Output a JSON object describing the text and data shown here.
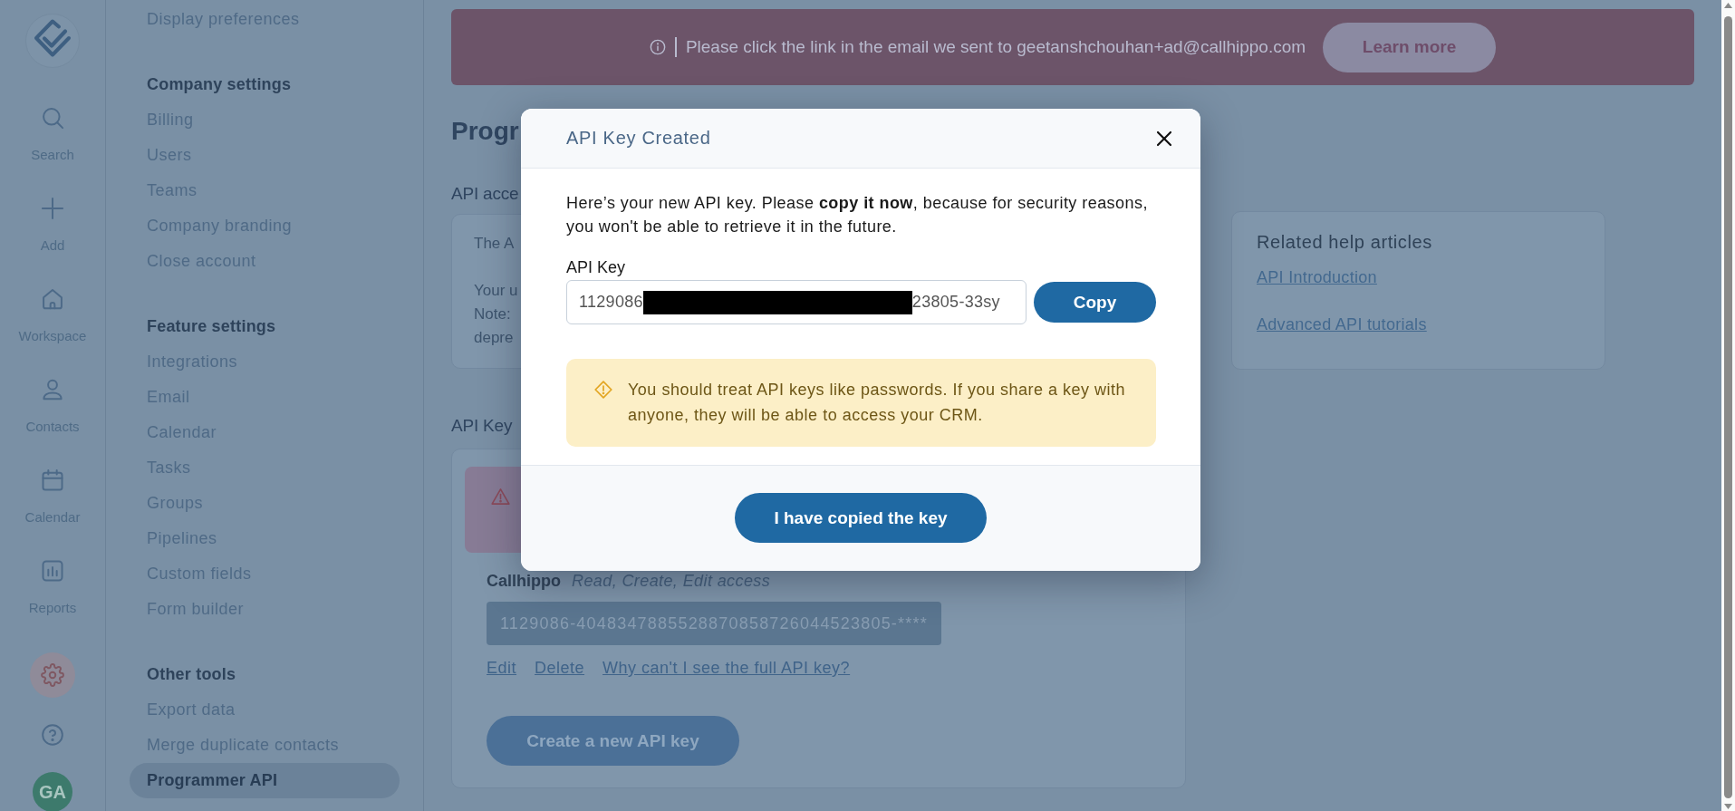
{
  "nav_rail": {
    "items": [
      {
        "label": "Search",
        "selected": false
      },
      {
        "label": "Add",
        "selected": false
      },
      {
        "label": "Workspace",
        "selected": false
      },
      {
        "label": "Contacts",
        "selected": false
      },
      {
        "label": "Calendar",
        "selected": false
      },
      {
        "label": "Reports",
        "selected": false
      }
    ],
    "bottom_items": [
      {
        "selected": true
      },
      {
        "selected": false
      }
    ],
    "avatar": {
      "initials": "GA"
    }
  },
  "sidebar": {
    "sections": [
      {
        "items": [
          {
            "label": "Display preferences",
            "selected": false
          }
        ]
      },
      {
        "title": "Company settings",
        "items": [
          {
            "label": "Billing",
            "selected": false
          },
          {
            "label": "Users",
            "selected": false
          },
          {
            "label": "Teams",
            "selected": false
          },
          {
            "label": "Company branding",
            "selected": false
          },
          {
            "label": "Close account",
            "selected": false
          }
        ]
      },
      {
        "title": "Feature settings",
        "items": [
          {
            "label": "Integrations",
            "selected": false
          },
          {
            "label": "Email",
            "selected": false
          },
          {
            "label": "Calendar",
            "selected": false
          },
          {
            "label": "Tasks",
            "selected": false
          },
          {
            "label": "Groups",
            "selected": false
          },
          {
            "label": "Pipelines",
            "selected": false
          },
          {
            "label": "Custom fields",
            "selected": false
          },
          {
            "label": "Form builder",
            "selected": false
          }
        ]
      },
      {
        "title": "Other tools",
        "items": [
          {
            "label": "Export data",
            "selected": false
          },
          {
            "label": "Merge duplicate contacts",
            "selected": false
          },
          {
            "label": "Programmer API",
            "selected": true
          }
        ]
      }
    ]
  },
  "banner": {
    "message": "Please click the link in the email we sent to geetanshchouhan+ad@callhippo.com",
    "button": "Learn more"
  },
  "page": {
    "title": "Progr",
    "access_section": {
      "heading": "API acce",
      "paragraphs": [
        {
          "lines": [
            "The A"
          ]
        },
        {
          "lines": [
            "Your u",
            "Note:",
            "depre"
          ]
        }
      ]
    },
    "keys_section": {
      "heading": "API Key",
      "keys": [
        {
          "name": "Callhippo",
          "access": "Read, Create, Edit access",
          "masked_value": "1129086-4048347885528870858726044523805-****",
          "links": [
            "Edit",
            "Delete",
            "Why can't I see the full API key?"
          ]
        }
      ],
      "create_button": "Create a new API key"
    },
    "help_card": {
      "title": "Related help articles",
      "links": [
        "API Introduction",
        "Advanced API tutorials"
      ]
    }
  },
  "modal": {
    "title": "API Key Created",
    "intro": "Here’s your new API key. Please **copy it now**, because for security reasons, you won't be able to retrieve it in the future.",
    "field_label": "API Key",
    "key_field": {
      "value_start": "1129086",
      "redacted": true,
      "value_end": "23805-33sy"
    },
    "copy_button": "Copy",
    "warning": "You should treat API keys like passwords. If you share a key with anyone, they will be able to access your CRM.",
    "confirm_button": "I have copied the key"
  }
}
